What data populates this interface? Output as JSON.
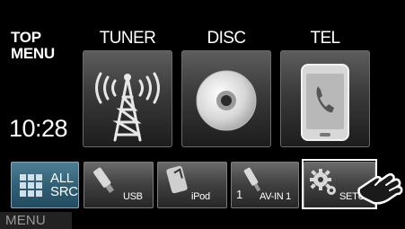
{
  "header": {
    "top_menu": "TOP\nMENU",
    "clock": "10:28"
  },
  "tiles": [
    {
      "label": "TUNER",
      "icon": "radio-tower-icon"
    },
    {
      "label": "DISC",
      "icon": "disc-icon"
    },
    {
      "label": "TEL",
      "icon": "phone-icon"
    }
  ],
  "sources": {
    "all_src": "ALL\nSRC",
    "usb": "USB",
    "ipod": "iPod",
    "av_in_number": "1",
    "av_in": "AV-IN 1",
    "setup": "SETUP"
  },
  "footer": {
    "menu": "MENU"
  },
  "colors": {
    "all_src_accent": "#2f5e74",
    "background": "#000000"
  }
}
